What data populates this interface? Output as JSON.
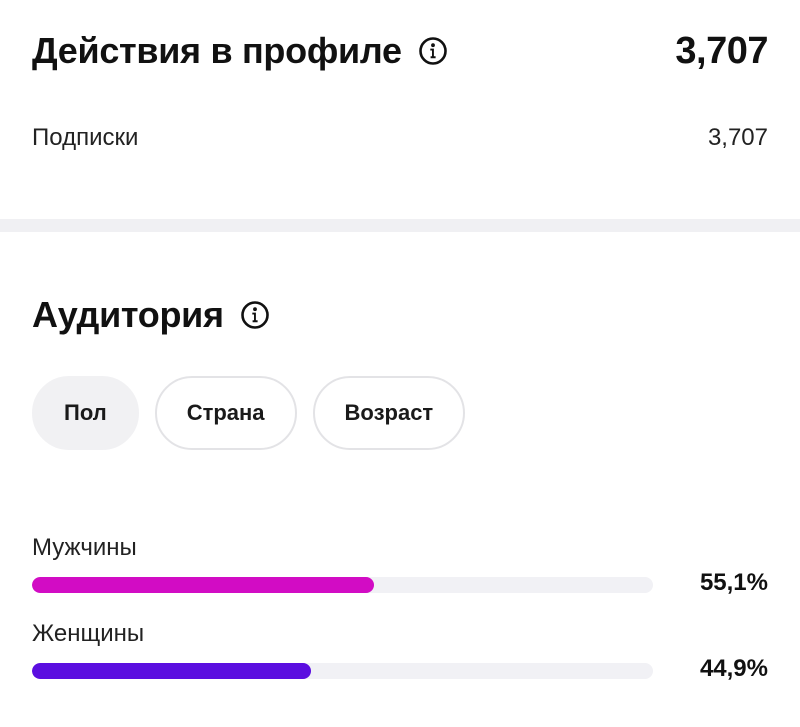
{
  "profile_actions": {
    "title": "Действия в профиле",
    "total": "3,707",
    "info_icon": "info-icon",
    "metrics": [
      {
        "label": "Подписки",
        "value": "3,707"
      }
    ]
  },
  "audience": {
    "title": "Аудитория",
    "info_icon": "info-icon",
    "tabs": [
      {
        "label": "Пол",
        "active": true
      },
      {
        "label": "Страна",
        "active": false
      },
      {
        "label": "Возраст",
        "active": false
      }
    ],
    "gender": [
      {
        "label": "Мужчины",
        "percent_text": "55,1%",
        "fraction": 0.551,
        "color": "#d20cc4"
      },
      {
        "label": "Женщины",
        "percent_text": "44,9%",
        "fraction": 0.449,
        "color": "#5b0ee0"
      }
    ]
  },
  "colors": {
    "divider": "#f0f0f3",
    "track": "#f1f1f5",
    "text": "#111111"
  }
}
